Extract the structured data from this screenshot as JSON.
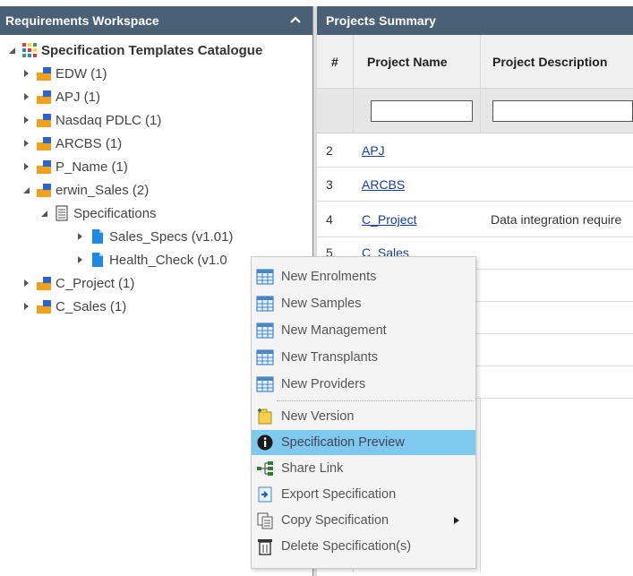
{
  "left_panel": {
    "title": "Requirements Workspace",
    "tree": {
      "root": "Specification Templates Catalogue",
      "items": [
        {
          "label": "EDW (1)"
        },
        {
          "label": "APJ (1)"
        },
        {
          "label": "Nasdaq PDLC (1)"
        },
        {
          "label": "ARCBS (1)"
        },
        {
          "label": "P_Name (1)"
        },
        {
          "label": "erwin_Sales (2)"
        },
        {
          "label": "Specifications"
        },
        {
          "label": "Sales_Specs (v1.01)"
        },
        {
          "label": "Health_Check (v1.0"
        },
        {
          "label": "C_Project (1)"
        },
        {
          "label": "C_Sales (1)"
        }
      ]
    }
  },
  "right_panel": {
    "title": "Projects Summary",
    "columns": [
      "#",
      "Project Name",
      "Project Description"
    ],
    "rows": [
      {
        "num": "2",
        "name": "APJ",
        "desc": ""
      },
      {
        "num": "3",
        "name": "ARCBS",
        "desc": ""
      },
      {
        "num": "4",
        "name": "C_Project",
        "desc": "Data integration require"
      },
      {
        "num": "5",
        "name": "C_Sales",
        "desc": ""
      }
    ]
  },
  "context_menu": {
    "items": [
      {
        "label": "New Enrolments",
        "icon": "table-icon"
      },
      {
        "label": "New Samples",
        "icon": "table-icon"
      },
      {
        "label": "New Management",
        "icon": "table-icon"
      },
      {
        "label": "New Transplants",
        "icon": "table-icon"
      },
      {
        "label": "New Providers",
        "icon": "table-icon"
      },
      {
        "label": "New Version",
        "icon": "new-version-icon"
      },
      {
        "label": "Specification Preview",
        "icon": "info-icon"
      },
      {
        "label": "Share Link",
        "icon": "share-link-icon"
      },
      {
        "label": "Export Specification",
        "icon": "export-icon"
      },
      {
        "label": "Copy Specification",
        "icon": "copy-icon"
      },
      {
        "label": "Delete Specification(s)",
        "icon": "trash-icon"
      }
    ],
    "highlighted": "Specification Preview"
  },
  "colors": {
    "header_bg": "#4a6074",
    "highlight": "#7fc8ee",
    "link": "#1a3e9e",
    "folder_orange": "#f0a020",
    "folder_blue": "#2f63c8",
    "doc_blue": "#1e88e5"
  }
}
